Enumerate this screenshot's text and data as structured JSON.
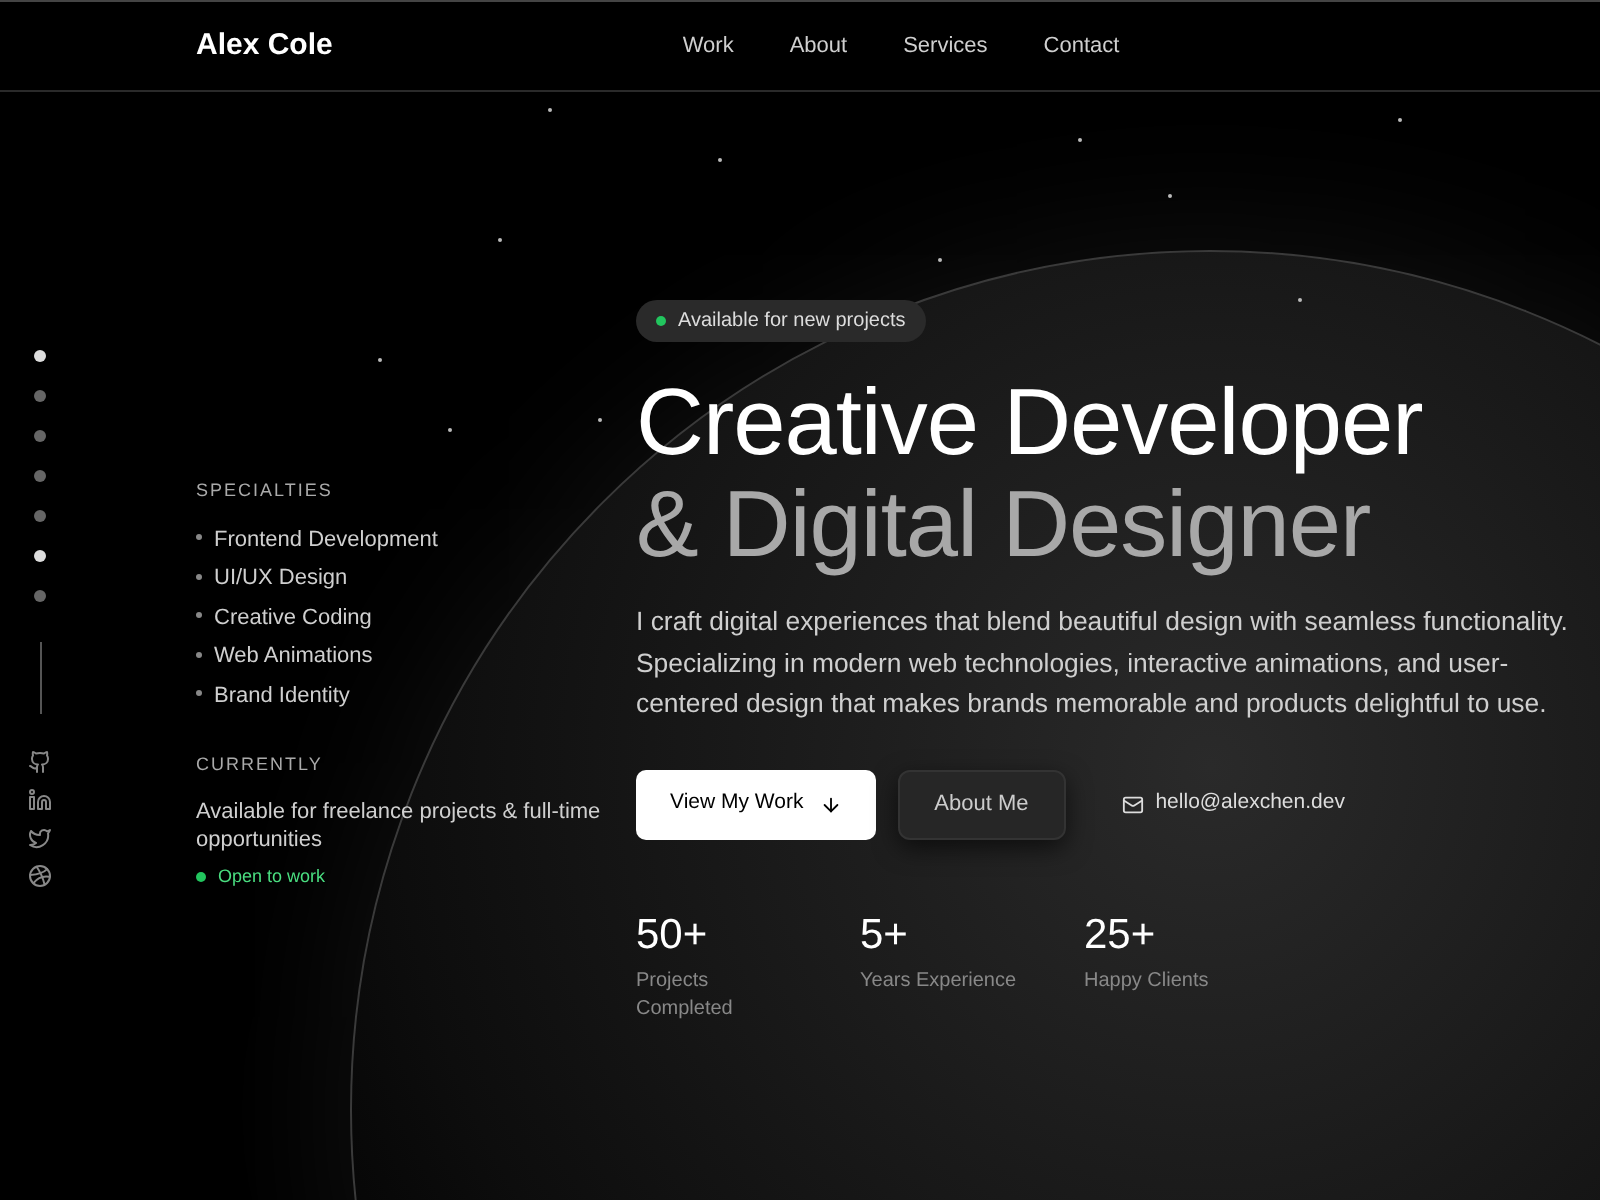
{
  "header": {
    "brand": "Alex Cole",
    "nav": [
      {
        "label": "Work"
      },
      {
        "label": "About"
      },
      {
        "label": "Services"
      },
      {
        "label": "Contact"
      }
    ]
  },
  "section_dots": [
    {
      "selected": true
    },
    {
      "selected": false
    },
    {
      "selected": false
    },
    {
      "selected": false
    },
    {
      "selected": false
    },
    {
      "selected": true
    },
    {
      "selected": false
    }
  ],
  "social": [
    {
      "kind": "github"
    },
    {
      "kind": "linkedin"
    },
    {
      "kind": "twitter"
    },
    {
      "kind": "dribbble"
    }
  ],
  "specialties": {
    "heading": "SPECIALTIES",
    "items": [
      "Frontend Development",
      "UI/UX Design",
      "Creative Coding",
      "Web Animations",
      "Brand Identity"
    ]
  },
  "currently": {
    "heading": "CURRENTLY",
    "text": "Available for freelance projects & full-time opportunities",
    "status": "Open to work"
  },
  "hero": {
    "badge": "Available for new projects",
    "title_line_1": "Creative Developer",
    "title_line_2": "& Digital Designer",
    "description": "I craft digital experiences that blend beautiful design with seamless functionality. Specializing in modern web technologies, interactive animations, and user-centered design that makes brands memorable and products delightful to use.",
    "primary_button": "View My Work",
    "secondary_button": "About Me",
    "email": "hello@alexchen.dev",
    "stats": [
      {
        "value": "50+",
        "label": "Projects Completed"
      },
      {
        "value": "5+",
        "label": "Years Experience"
      },
      {
        "value": "25+",
        "label": "Happy Clients"
      }
    ]
  }
}
